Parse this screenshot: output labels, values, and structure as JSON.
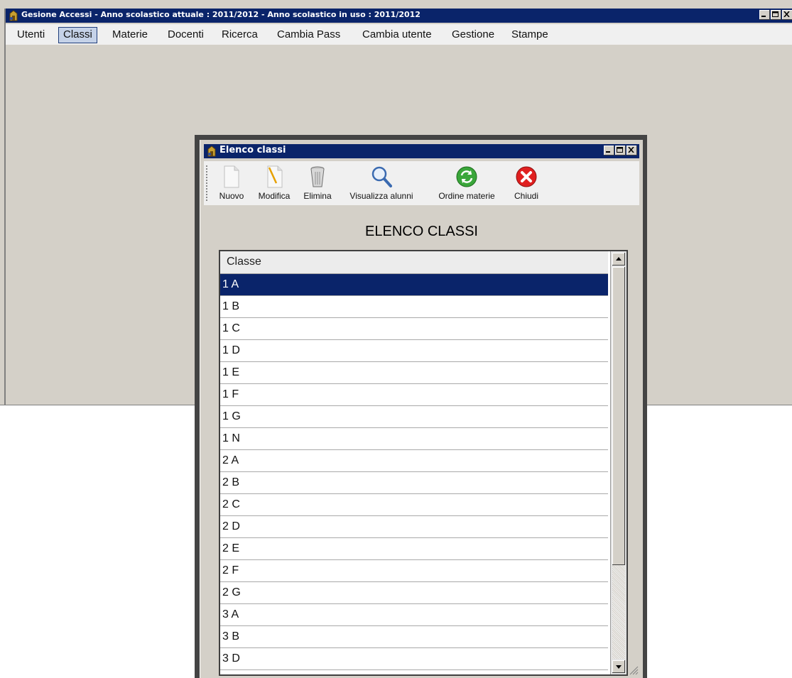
{
  "main_window": {
    "title": "Gesione Accessi - Anno scolastico attuale : 2011/2012 - Anno scolastico in uso : 2011/2012",
    "menu": [
      "Utenti",
      "Classi",
      "Materie",
      "Docenti",
      "Ricerca",
      "Cambia Pass",
      "Cambia utente",
      "Gestione",
      "Stampe"
    ],
    "active_menu": "Classi"
  },
  "dialog": {
    "title": "Elenco classi",
    "toolbar": {
      "nuovo": "Nuovo",
      "modifica": "Modifica",
      "elimina": "Elimina",
      "visualizza": "Visualizza alunni",
      "ordine": "Ordine materie",
      "chiudi": "Chiudi"
    },
    "heading": "ELENCO CLASSI",
    "table": {
      "column": "Classe",
      "rows": [
        "1 A",
        "1 B",
        "1 C",
        "1 D",
        "1 E",
        "1 F",
        "1 G",
        "1 N",
        "2 A",
        "2 B",
        "2 C",
        "2 D",
        "2 E",
        "2 F",
        "2 G",
        "3 A",
        "3 B",
        "3 D"
      ],
      "selected_index": 0
    }
  },
  "colors": {
    "titlebar": "#0a246a",
    "window_face": "#d4d0c8",
    "selection": "#0a246a"
  }
}
